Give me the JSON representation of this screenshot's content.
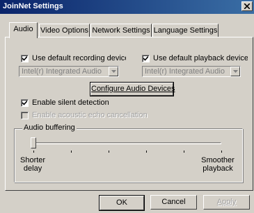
{
  "window": {
    "title": "JoinNet Settings"
  },
  "tabs": [
    {
      "label": "Audio",
      "active": true
    },
    {
      "label": "Video Options",
      "active": false
    },
    {
      "label": "Network Settings",
      "active": false
    },
    {
      "label": "Language Settings",
      "active": false
    }
  ],
  "audio": {
    "recording": {
      "checkbox_label": "Use default recording device",
      "checked": true,
      "device": "Intel(r) Integrated Audio"
    },
    "playback": {
      "checkbox_label": "Use default playback device",
      "checked": true,
      "device": "Intel(r) Integrated Audio"
    },
    "configure_button": "Configure Audio Devices",
    "silent_detection": {
      "label": "Enable silent detection",
      "checked": true
    },
    "echo_cancellation": {
      "label": "Enable acoustic echo cancellation",
      "checked": false,
      "enabled": false
    },
    "buffering": {
      "group_label": "Audio buffering",
      "left_label_line1": "Shorter",
      "left_label_line2": "delay",
      "right_label_line1": "Smoother",
      "right_label_line2": "playback",
      "slider_value": 0
    }
  },
  "buttons": {
    "ok": "OK",
    "cancel": "Cancel",
    "apply": "Apply"
  }
}
